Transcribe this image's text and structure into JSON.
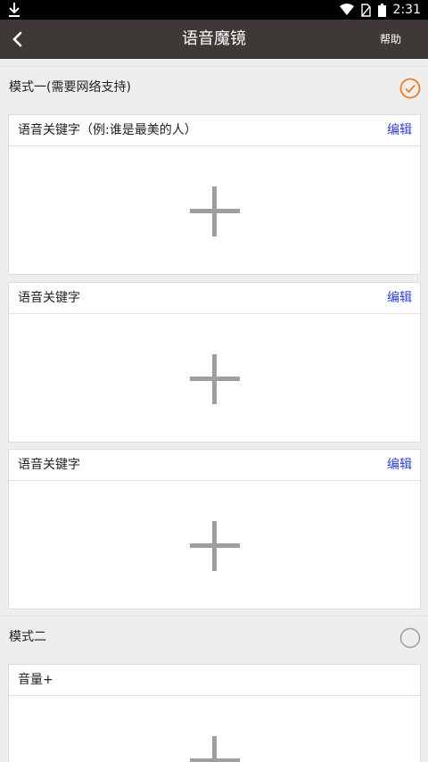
{
  "status_bar": {
    "time": "2:31"
  },
  "app_bar": {
    "title": "语音魔镜",
    "help_label": "帮助"
  },
  "mode1": {
    "label": "模式一(需要网络支持)",
    "selected": true,
    "accent_color": "#f07d1e",
    "cards": [
      {
        "keyword": "语音关键字（例:谁是最美的人）",
        "edit_label": "编辑"
      },
      {
        "keyword": "语音关键字",
        "edit_label": "编辑"
      },
      {
        "keyword": "语音关键字",
        "edit_label": "编辑"
      }
    ]
  },
  "mode2": {
    "label": "模式二",
    "selected": false,
    "cards": [
      {
        "keyword": "音量+"
      }
    ]
  },
  "colors": {
    "app_bar": "#3e3936",
    "edit_link": "#2b3fd9",
    "plus": "#9e9e9e"
  }
}
